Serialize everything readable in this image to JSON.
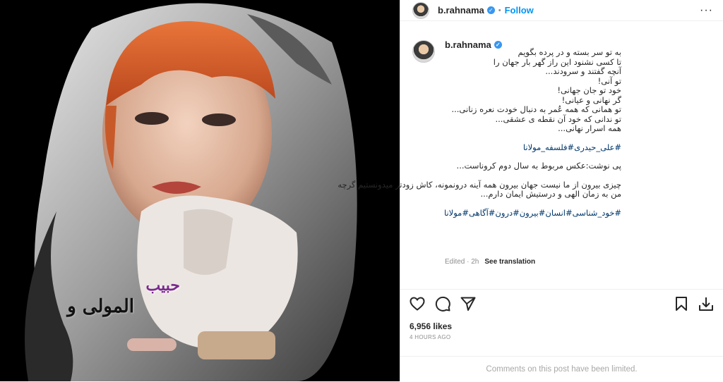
{
  "post": {
    "username": "b.rahnama",
    "verified_icon": "verified-badge-icon",
    "follow_label": "Follow",
    "dot": "•",
    "more_label": "···",
    "caption_lines": [
      "به تو سر بسته و در پرده بگویم",
      "تا کسی نشنود این راز گهر بار جهان را",
      "آنچه گفتند و سرودند...",
      "تو آنی!",
      "خود تو جان جهانی!",
      "گر نهانی و عیانی!",
      "تو همانی که همه عُمر به دنبال خودت نعره زنانی...",
      "تو ندانی که خود آن نقطه ی عشقی...",
      "همه اسرار نهانی..."
    ],
    "hashtags_1": "#علی_حیدری#فلسفه_مولانا",
    "note": "پی نوشت:عکس مربوط به سال دوم کروناست...",
    "para_lines": [
      "چیزی بیرون از ما نیست جهان بیرون همه آینه درونمونه، کاش زودتر میدونستیم گرچه",
      "من به زمان الهی و درستیش ایمان دارم..."
    ],
    "hashtags_2": "#خود_شناسی#انسان#بیرون#درون#آگاهی#مولانا",
    "edited": "Edited · 2h",
    "see_translation": "See translation",
    "likes": "6,956 likes",
    "time_ago": "4 HOURS AGO",
    "comments_limited": "Comments on this post have been limited.",
    "image_text_1": "حبیب",
    "image_text_2": "المولی و"
  },
  "colors": {
    "link": "#0095f6",
    "hashtag": "#00376b",
    "muted": "#8e8e8e"
  }
}
